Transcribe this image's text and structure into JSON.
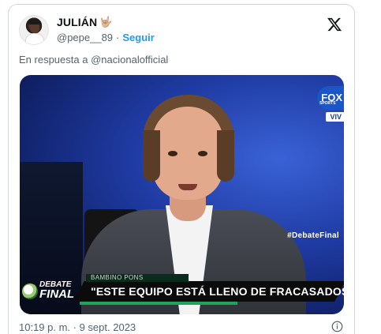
{
  "tweet": {
    "display_name": "JULIÁN",
    "name_emoji": "🤟🏼",
    "handle": "@pepe__89",
    "separator": "·",
    "follow_label": "Seguir",
    "reply_prefix": "En respuesta a",
    "reply_target": "@nacionalofficial",
    "timestamp": "10:19 p. m. · 9 sept. 2023"
  },
  "media": {
    "channel_logo": "FOX",
    "channel_logo_sub": "SPORTS",
    "live_badge": "VIV",
    "hashtag": "#DebateFinal",
    "show_logo_line1": "DEBATE",
    "show_logo_line2": "FINAL",
    "speaker_tag": "BAMBINO PONS",
    "quote": "\"ESTE EQUIPO ESTÁ LLENO DE FRACASADOS\""
  },
  "icons": {
    "platform": "x-logo-icon",
    "info": "info-icon"
  },
  "colors": {
    "accent": "#1d9bf0",
    "text_secondary": "#536471",
    "border": "#cfd9de"
  }
}
